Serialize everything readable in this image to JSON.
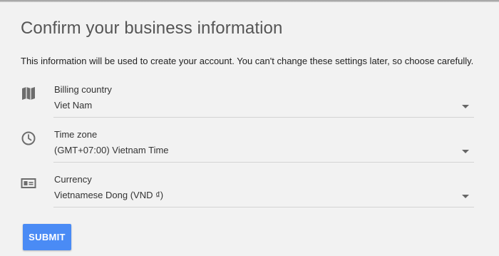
{
  "page": {
    "title": "Confirm your business information",
    "description": "This information will be used to create your account. You can't change these settings later, so choose carefully."
  },
  "fields": [
    {
      "icon": "map-icon",
      "label": "Billing country",
      "value": "Viet Nam"
    },
    {
      "icon": "clock-icon",
      "label": "Time zone",
      "value": "(GMT+07:00) Vietnam Time"
    },
    {
      "icon": "currency-icon",
      "label": "Currency",
      "value": "Vietnamese Dong (VND ₫)"
    }
  ],
  "actions": {
    "submit_label": "SUBMIT"
  },
  "colors": {
    "background": "#f2f2f2",
    "accent": "#4a8bf5",
    "icon": "#6d6d6d",
    "divider": "#d4d4d4"
  }
}
